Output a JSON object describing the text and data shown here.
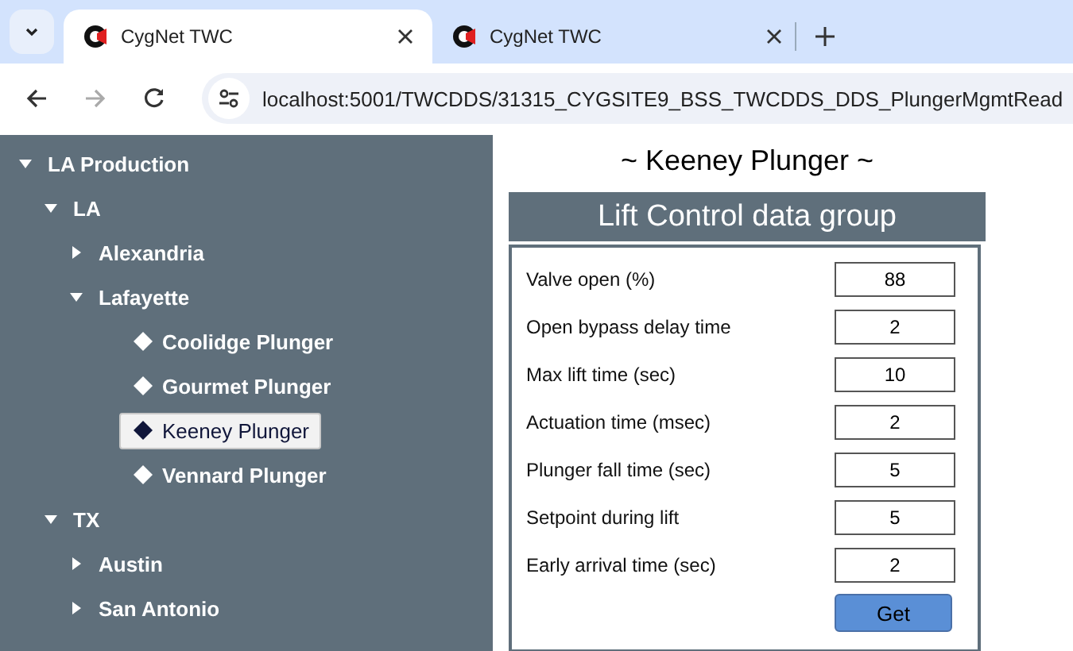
{
  "browser": {
    "tabs": [
      {
        "title": "CygNet TWC",
        "selected": true
      },
      {
        "title": "CygNet TWC",
        "selected": false
      }
    ],
    "address": "localhost:5001/TWCDDS/31315_CYGSITE9_BSS_TWCDDS_DDS_PlungerMgmtRead",
    "forward_disabled": true
  },
  "tree": [
    {
      "kind": "branch",
      "label": "LA Production",
      "expanded": true,
      "children": [
        {
          "kind": "branch",
          "label": "LA",
          "expanded": true,
          "children": [
            {
              "kind": "branch",
              "label": "Alexandria",
              "expanded": false
            },
            {
              "kind": "branch",
              "label": "Lafayette",
              "expanded": true,
              "children": [
                {
                  "kind": "leaf",
                  "label": "Coolidge Plunger",
                  "selected": false
                },
                {
                  "kind": "leaf",
                  "label": "Gourmet Plunger",
                  "selected": false
                },
                {
                  "kind": "leaf",
                  "label": "Keeney Plunger",
                  "selected": true
                },
                {
                  "kind": "leaf",
                  "label": "Vennard Plunger",
                  "selected": false
                }
              ]
            }
          ]
        },
        {
          "kind": "branch",
          "label": "TX",
          "expanded": true,
          "children": [
            {
              "kind": "branch",
              "label": "Austin",
              "expanded": false
            },
            {
              "kind": "branch",
              "label": "San Antonio",
              "expanded": false
            }
          ]
        }
      ]
    }
  ],
  "page_title": "~ Keeney Plunger ~",
  "group": {
    "title": "Lift Control data group",
    "fields": [
      {
        "label": "Valve open (%)",
        "value": "88"
      },
      {
        "label": "Open bypass delay time",
        "value": "2"
      },
      {
        "label": "Max lift time (sec)",
        "value": "10"
      },
      {
        "label": "Actuation time (msec)",
        "value": "2"
      },
      {
        "label": "Plunger fall time (sec)",
        "value": "5"
      },
      {
        "label": "Setpoint during lift",
        "value": "5"
      },
      {
        "label": "Early arrival time (sec)",
        "value": "2"
      }
    ],
    "button": "Get"
  }
}
